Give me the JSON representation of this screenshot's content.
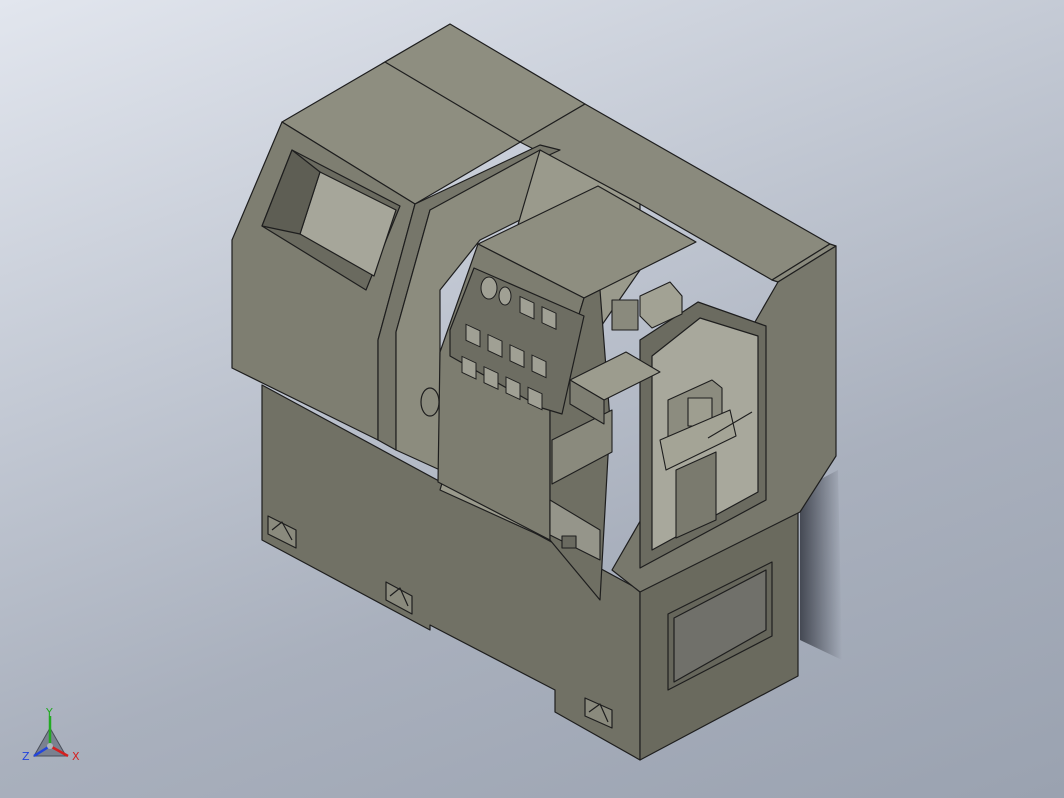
{
  "viewport": {
    "background_top": "#e2e6ee",
    "background_bottom": "#9aa2b0"
  },
  "model": {
    "subject": "cnc-lathe",
    "body_color": "#7c7c6e",
    "body_dark": "#63635a",
    "body_light": "#8e8e80",
    "edge_color": "#1e1e1e"
  },
  "triad": {
    "x_label": "X",
    "y_label": "Y",
    "z_label": "Z",
    "x_color": "#d42020",
    "y_color": "#22aa22",
    "z_color": "#2244dd"
  }
}
